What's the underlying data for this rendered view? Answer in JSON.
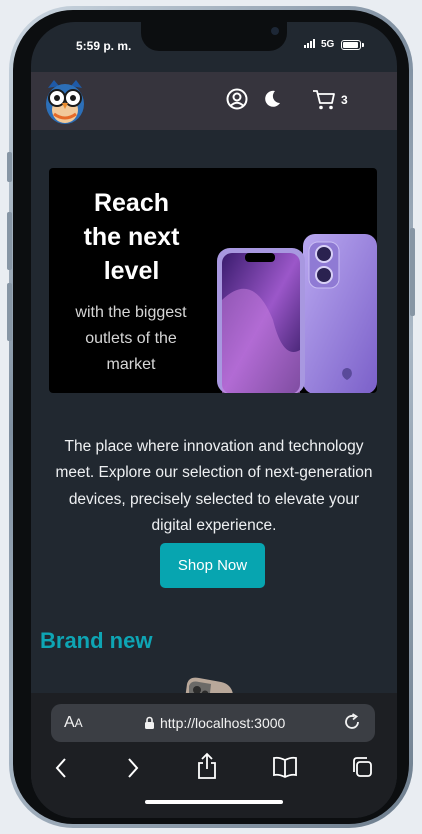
{
  "status_bar": {
    "time": "5:59 p. m.",
    "network": "5G"
  },
  "navbar": {
    "cart_count": "3",
    "icons": [
      "owl-logo",
      "user-icon",
      "moon-icon",
      "cart-icon"
    ]
  },
  "hero": {
    "title_lines": [
      "Reach",
      "the next",
      "level"
    ],
    "subtitle_lines": [
      "with the biggest",
      "outlets of the",
      "market"
    ]
  },
  "description": "The place where innovation and technology meet. Explore our selection of next-generation devices, precisely selected to elevate your digital experience.",
  "cta": {
    "label": "Shop Now"
  },
  "section": {
    "title": "Brand new"
  },
  "browser": {
    "text_size_label": "AA",
    "url": "http://localhost:3000",
    "toolbar": [
      "back-icon",
      "forward-icon",
      "share-icon",
      "bookmarks-icon",
      "tabs-icon"
    ]
  },
  "colors": {
    "accent": "#07a5b0",
    "background": "#212830",
    "navbar": "#36343d",
    "hero_bg": "#000000"
  }
}
